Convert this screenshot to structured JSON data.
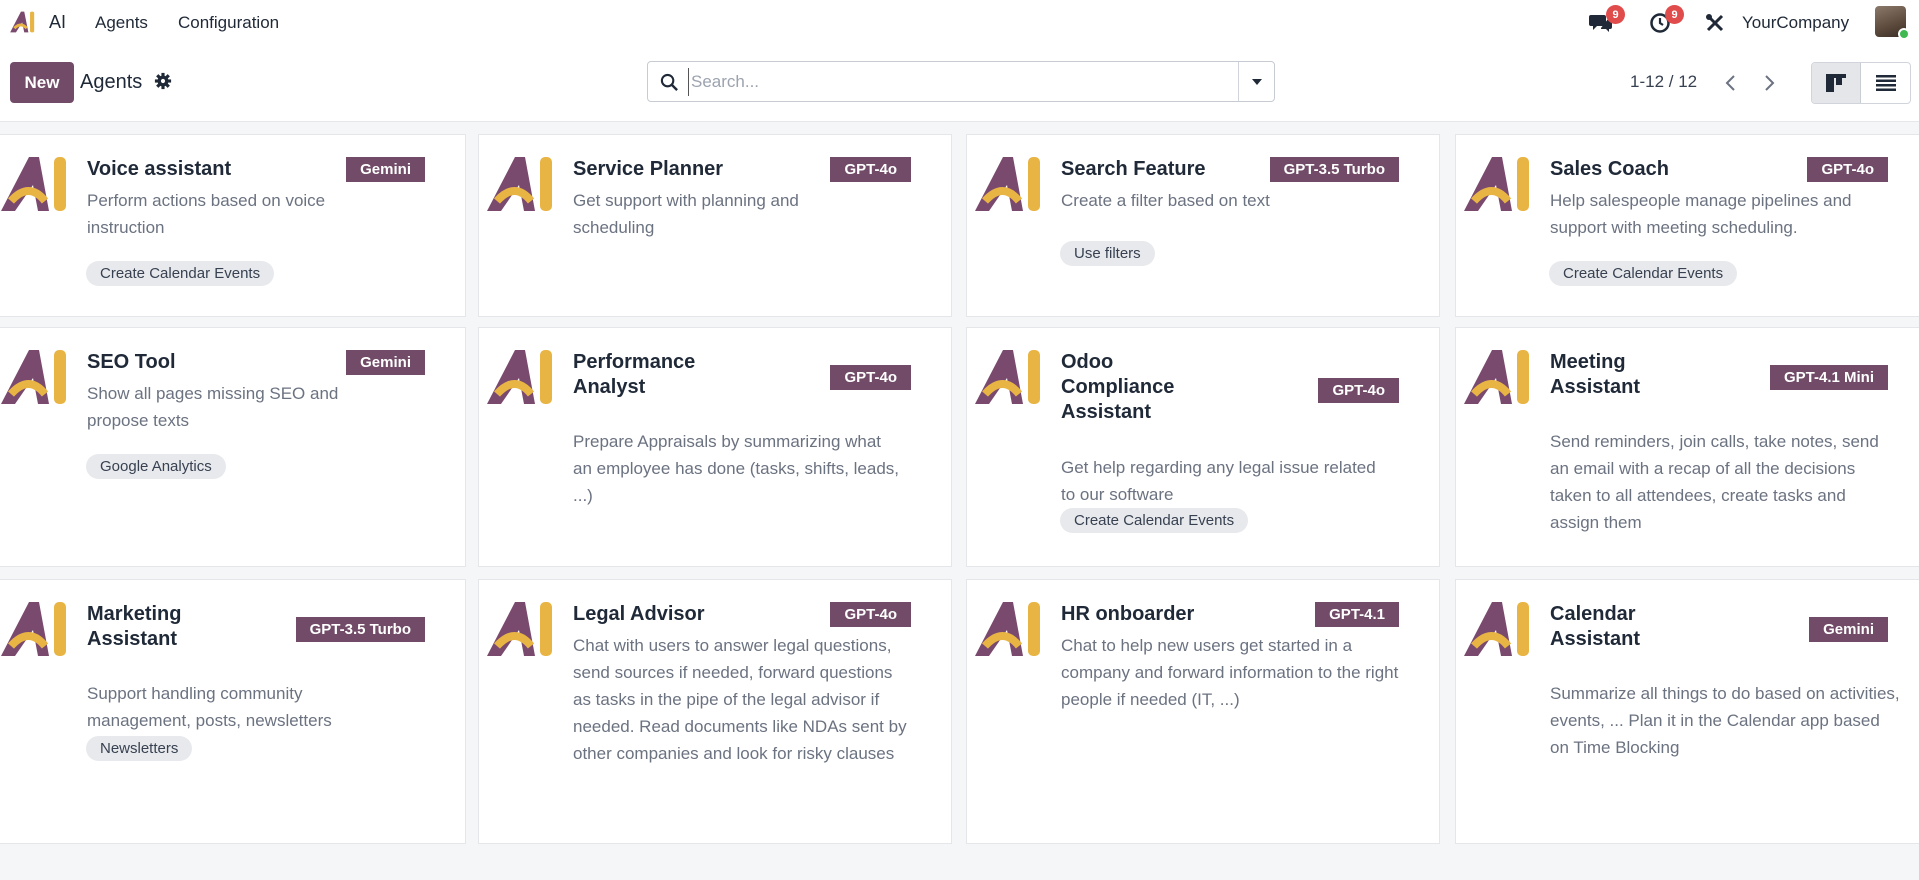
{
  "navbar": {
    "app_name": "AI",
    "menu": [
      "Agents",
      "Configuration"
    ],
    "messages_count": "9",
    "activities_count": "9",
    "company": "YourCompany"
  },
  "control": {
    "new_label": "New",
    "title": "Agents",
    "search_placeholder": "Search...",
    "pager": "1-12 / 12"
  },
  "colors": {
    "brand": "#714b67",
    "badge": "#e04b4b",
    "logo_purple": "#7a4a6e",
    "logo_gold": "#e8b443"
  },
  "cards": [
    {
      "title": "Voice assistant",
      "model": "Gemini",
      "desc": "Perform actions based on voice instruction",
      "tag": "Create Calendar Events"
    },
    {
      "title": "Service Planner",
      "model": "GPT-4o",
      "desc": "Get support with planning and scheduling",
      "tag": ""
    },
    {
      "title": "Search Feature",
      "model": "GPT-3.5 Turbo",
      "desc": "Create a filter based on text",
      "tag": "Use filters"
    },
    {
      "title": "Sales Coach",
      "model": "GPT-4o",
      "desc": "Help salespeople manage pipelines and support with meeting scheduling.",
      "tag": "Create Calendar Events"
    },
    {
      "title": "SEO Tool",
      "model": "Gemini",
      "desc": "Show all pages missing SEO and propose texts",
      "tag": "Google Analytics"
    },
    {
      "title": "Performance Analyst",
      "model": "GPT-4o",
      "desc": "Prepare Appraisals by summarizing what an employee has done (tasks, shifts, leads, ...)",
      "tag": ""
    },
    {
      "title": "Odoo Compliance Assistant",
      "model": "GPT-4o",
      "desc": "Get help regarding any legal issue related to our software",
      "tag": "Create Calendar Events"
    },
    {
      "title": "Meeting Assistant",
      "model": "GPT-4.1 Mini",
      "desc": "Send reminders, join calls, take notes, send an email with a recap of all the decisions taken to all attendees, create tasks and assign them",
      "tag": ""
    },
    {
      "title": "Marketing Assistant",
      "model": "GPT-3.5 Turbo",
      "desc": "Support handling community management, posts, newsletters",
      "tag": "Newsletters"
    },
    {
      "title": "Legal Advisor",
      "model": "GPT-4o",
      "desc": "Chat with users to answer legal questions, send sources if needed, forward questions as tasks in the pipe of the legal advisor if needed. Read documents like NDAs sent by other companies and look for risky clauses",
      "tag": ""
    },
    {
      "title": "HR onboarder",
      "model": "GPT-4.1",
      "desc": "Chat to help new users get started in a company and forward information to the right people if needed (IT, ...)",
      "tag": ""
    },
    {
      "title": "Calendar Assistant",
      "model": "Gemini",
      "desc": "Summarize all things to do based on activities, events, ... Plan it in the Calendar app based on Time Blocking",
      "tag": ""
    }
  ]
}
